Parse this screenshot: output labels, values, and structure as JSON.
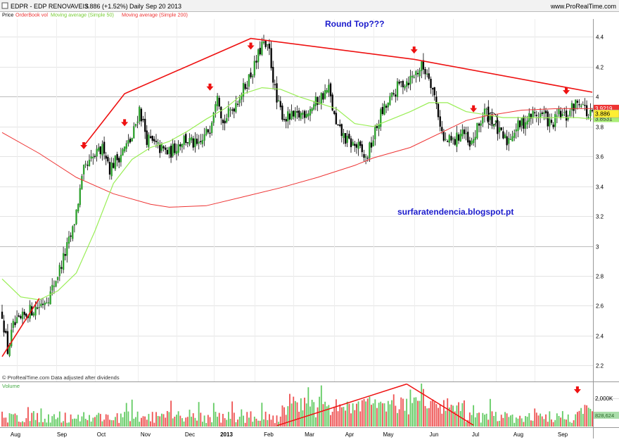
{
  "header": {
    "symbol": "EDPR - EDP RENOVAVEIS",
    "quote": "3.886 (+1.52%)",
    "period": "Daily",
    "date": "Sep 20 2013",
    "site": "www.ProRealTime.com"
  },
  "legend": {
    "price": "Price",
    "orderbook": "OrderBook vol",
    "ma50": "Moving average (Simple 50)",
    "ma200": "Moving average (Simple 200)"
  },
  "annotations": {
    "title": "Round Top???",
    "blog": "surfaratendencia.blogspot.pt",
    "footer": "© ProRealTime.com  Data adjusted after dividends",
    "volume_label": "Volume"
  },
  "colors": {
    "up": "#2ca02c",
    "down": "#000000",
    "ma50": "#99ee55",
    "ma200": "#ee3333",
    "trend": "#ee1111",
    "vol_up": "#66cc66",
    "vol_down": "#ee5555",
    "title": "#1a1acc",
    "price_tag": "#ffee33",
    "ma200_tag": "#ee3333",
    "ma50_tag": "#aaee77"
  },
  "chart_data": {
    "type": "candlestick",
    "price_axis": {
      "ylim": [
        2.15,
        4.52
      ],
      "ticks": [
        2.2,
        2.4,
        2.6,
        2.8,
        3,
        3.2,
        3.4,
        3.6,
        3.8,
        4,
        4.2,
        4.4
      ]
    },
    "x_labels": [
      "Aug",
      "Sep",
      "Oct",
      "Nov",
      "Dec",
      "2013",
      "Feb",
      "Mar",
      "Apr",
      "May",
      "Jun",
      "Jul",
      "Aug",
      "Sep"
    ],
    "last_price": "3.886",
    "ma200_value": "3.9219",
    "ma50_value": "3.8531",
    "volume_axis": {
      "ticks": [
        "2,000K"
      ],
      "current": "828,624"
    },
    "close_profile": [
      [
        0,
        2.55
      ],
      [
        3,
        2.3
      ],
      [
        6,
        2.46
      ],
      [
        10,
        2.5
      ],
      [
        14,
        2.56
      ],
      [
        20,
        2.6
      ],
      [
        26,
        2.68
      ],
      [
        32,
        2.88
      ],
      [
        38,
        3.1
      ],
      [
        44,
        3.5
      ],
      [
        50,
        3.6
      ],
      [
        55,
        3.66
      ],
      [
        58,
        3.52
      ],
      [
        64,
        3.62
      ],
      [
        70,
        3.72
      ],
      [
        74,
        3.92
      ],
      [
        78,
        3.72
      ],
      [
        84,
        3.66
      ],
      [
        90,
        3.62
      ],
      [
        98,
        3.72
      ],
      [
        106,
        3.66
      ],
      [
        112,
        3.8
      ],
      [
        116,
        4.05
      ],
      [
        119,
        3.82
      ],
      [
        124,
        3.92
      ],
      [
        130,
        4.05
      ],
      [
        136,
        4.2
      ],
      [
        140,
        4.35
      ],
      [
        144,
        4.3
      ],
      [
        148,
        3.96
      ],
      [
        152,
        3.86
      ],
      [
        158,
        3.86
      ],
      [
        166,
        3.92
      ],
      [
        172,
        4.0
      ],
      [
        176,
        4.05
      ],
      [
        180,
        3.8
      ],
      [
        186,
        3.7
      ],
      [
        192,
        3.66
      ],
      [
        196,
        3.58
      ],
      [
        200,
        3.72
      ],
      [
        204,
        3.88
      ],
      [
        208,
        3.95
      ],
      [
        214,
        4.08
      ],
      [
        220,
        4.12
      ],
      [
        226,
        4.2
      ],
      [
        230,
        4.15
      ],
      [
        234,
        3.95
      ],
      [
        238,
        3.7
      ],
      [
        244,
        3.7
      ],
      [
        248,
        3.78
      ],
      [
        252,
        3.65
      ],
      [
        256,
        3.78
      ],
      [
        260,
        3.9
      ],
      [
        264,
        3.85
      ],
      [
        268,
        3.75
      ],
      [
        272,
        3.7
      ],
      [
        276,
        3.78
      ],
      [
        280,
        3.82
      ],
      [
        286,
        3.88
      ],
      [
        292,
        3.88
      ],
      [
        296,
        3.8
      ],
      [
        300,
        3.88
      ],
      [
        304,
        3.86
      ],
      [
        308,
        3.94
      ],
      [
        312,
        3.98
      ],
      [
        316,
        3.86
      ],
      [
        318,
        3.89
      ]
    ],
    "ma50": [
      [
        0,
        2.78
      ],
      [
        10,
        2.66
      ],
      [
        20,
        2.64
      ],
      [
        30,
        2.7
      ],
      [
        40,
        2.82
      ],
      [
        50,
        3.1
      ],
      [
        60,
        3.42
      ],
      [
        70,
        3.58
      ],
      [
        80,
        3.66
      ],
      [
        90,
        3.7
      ],
      [
        100,
        3.77
      ],
      [
        110,
        3.85
      ],
      [
        120,
        3.92
      ],
      [
        130,
        4.02
      ],
      [
        140,
        4.06
      ],
      [
        150,
        4.05
      ],
      [
        160,
        4.0
      ],
      [
        170,
        3.96
      ],
      [
        180,
        3.92
      ],
      [
        190,
        3.82
      ],
      [
        200,
        3.8
      ],
      [
        210,
        3.85
      ],
      [
        220,
        3.9
      ],
      [
        230,
        3.96
      ],
      [
        240,
        3.96
      ],
      [
        250,
        3.9
      ],
      [
        260,
        3.88
      ],
      [
        270,
        3.86
      ],
      [
        280,
        3.86
      ],
      [
        290,
        3.86
      ],
      [
        300,
        3.86
      ],
      [
        310,
        3.86
      ],
      [
        318,
        3.85
      ]
    ],
    "ma200": [
      [
        0,
        3.76
      ],
      [
        20,
        3.62
      ],
      [
        40,
        3.46
      ],
      [
        60,
        3.35
      ],
      [
        80,
        3.28
      ],
      [
        90,
        3.26
      ],
      [
        110,
        3.27
      ],
      [
        130,
        3.33
      ],
      [
        150,
        3.39
      ],
      [
        170,
        3.46
      ],
      [
        190,
        3.54
      ],
      [
        200,
        3.59
      ],
      [
        220,
        3.66
      ],
      [
        240,
        3.78
      ],
      [
        250,
        3.84
      ],
      [
        260,
        3.87
      ],
      [
        280,
        3.91
      ],
      [
        300,
        3.92
      ],
      [
        318,
        3.92
      ]
    ],
    "trendlines": [
      {
        "points": [
          [
            0,
            2.26
          ],
          [
            20,
            2.65
          ]
        ]
      },
      {
        "points": [
          [
            44,
            3.67
          ],
          [
            66,
            4.02
          ],
          [
            134,
            4.39
          ],
          [
            222,
            4.25
          ],
          [
            318,
            4.03
          ]
        ]
      }
    ],
    "volume_trendlines": [
      {
        "points": [
          [
            148,
            0.02
          ],
          [
            218,
            0.99
          ]
        ]
      },
      {
        "points": [
          [
            218,
            0.99
          ],
          [
            254,
            0.03
          ]
        ]
      }
    ],
    "arrow_markers": [
      44,
      66,
      112,
      134,
      222,
      254,
      304
    ],
    "volume_arrow": 310,
    "circle_marker": 264
  }
}
